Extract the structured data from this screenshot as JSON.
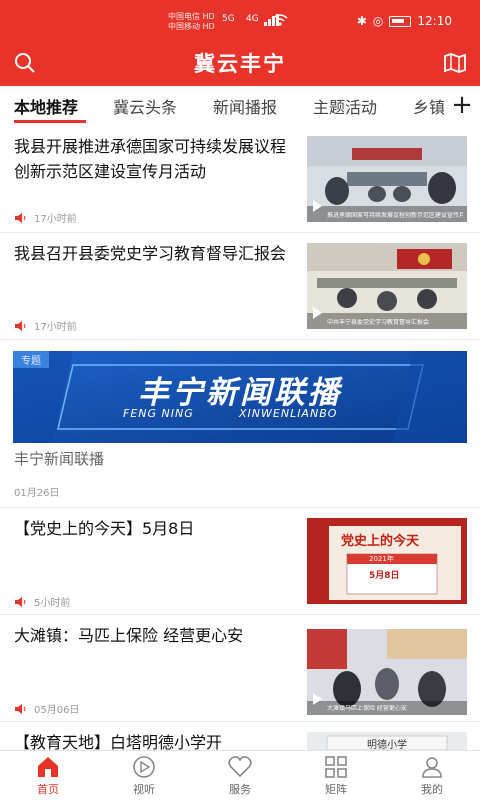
{
  "status_bar": {
    "carrier1": "中国电信 HD",
    "carrier2": "中国移动 HD",
    "signal1": "5G",
    "signal2": "4G",
    "time": "12:10"
  },
  "header": {
    "title": "冀云丰宁",
    "search_icon": "search-icon",
    "map_icon": "map-icon"
  },
  "tabs": [
    {
      "label": "本地推荐",
      "active": true
    },
    {
      "label": "冀云头条"
    },
    {
      "label": "新闻播报"
    },
    {
      "label": "主题活动"
    },
    {
      "label": "乡镇"
    }
  ],
  "tab_more": "+",
  "feed": {
    "items": [
      {
        "title": "我县开展推进承德国家可持续发展议程创新示范区建设宣传月活动",
        "meta": "17小时前",
        "thumb_caption": "推进承德国家可持续发展议程创新示范区建设宣传月活动"
      },
      {
        "title": "我县召开县委党史学习教育督导汇报会",
        "meta": "17小时前",
        "thumb_caption": "中共丰宁县委党史学习教育督导汇报会"
      },
      {
        "title": "【党史上的今天】5月8日",
        "meta": "5小时前",
        "thumb_title": "党史上的今天",
        "thumb_year": "2021年",
        "thumb_date": "5月8日"
      },
      {
        "title": "大滩镇：马匹上保险 经营更心安",
        "meta": "05月06日",
        "thumb_caption": "大滩镇马匹上保险 经营更心安"
      },
      {
        "title": "【教育天地】白塔明德小学开",
        "meta": "",
        "thumb_sign": "明德小学"
      }
    ],
    "banner": {
      "tag": "专题",
      "title": "丰宁新闻联播",
      "subtitle_left": "FENG NING",
      "subtitle_right": "XINWENLIANBO",
      "caption": "丰宁新闻联播",
      "date": "01月26日"
    }
  },
  "bottom_nav": [
    {
      "label": "首页",
      "icon": "home-icon",
      "active": true
    },
    {
      "label": "视听",
      "icon": "play-circle-icon"
    },
    {
      "label": "服务",
      "icon": "heart-icon"
    },
    {
      "label": "矩阵",
      "icon": "grid-icon"
    },
    {
      "label": "我的",
      "icon": "user-icon"
    }
  ],
  "colors": {
    "accent": "#e8332a"
  }
}
